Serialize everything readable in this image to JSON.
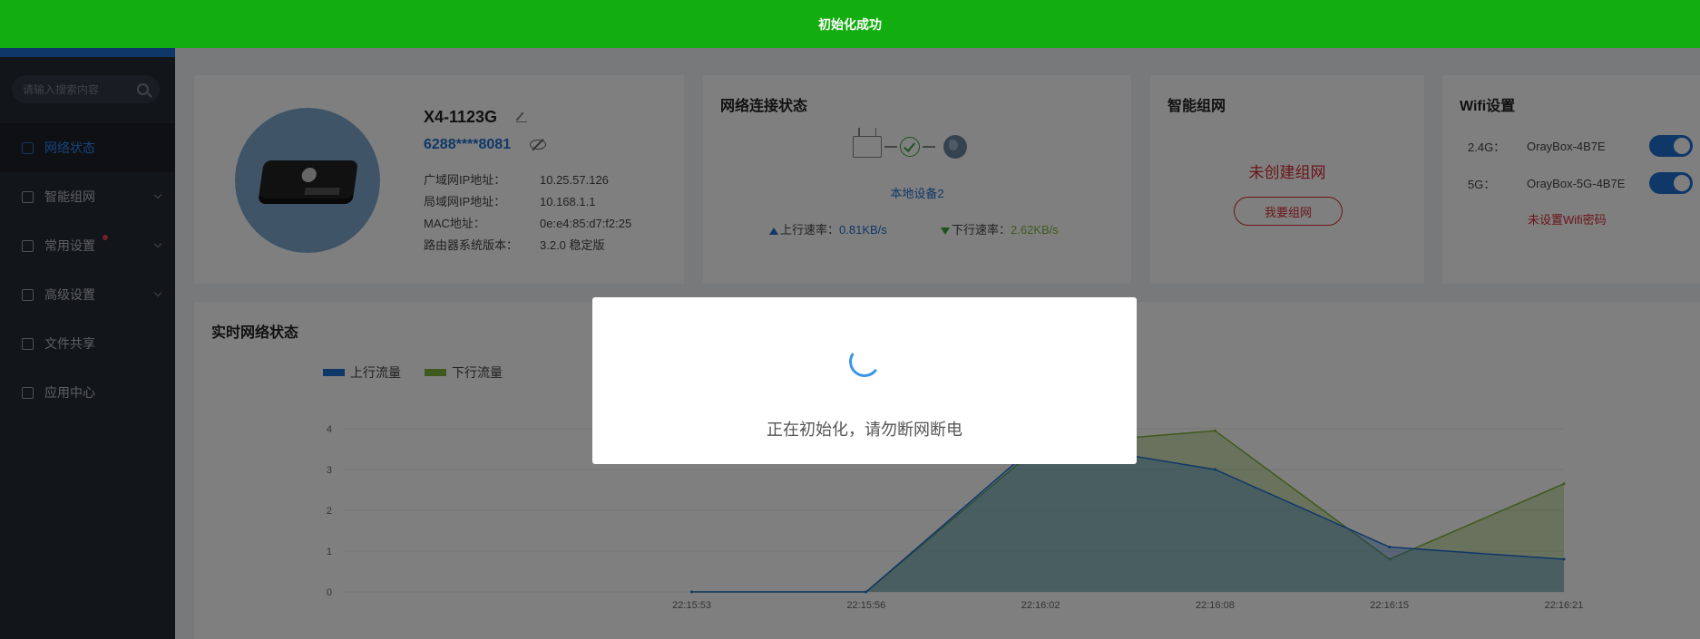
{
  "toast": {
    "message": "初始化成功"
  },
  "sidebar": {
    "search_placeholder": "请输入搜索内容",
    "items": [
      {
        "label": "网络状态",
        "icon": "network-status-icon",
        "active": true
      },
      {
        "label": "智能组网",
        "icon": "mesh-icon"
      },
      {
        "label": "常用设置",
        "icon": "settings-icon",
        "badge": true
      },
      {
        "label": "高级设置",
        "icon": "advanced-icon"
      },
      {
        "label": "文件共享",
        "icon": "folder-icon"
      },
      {
        "label": "应用中心",
        "icon": "app-icon"
      }
    ]
  },
  "device": {
    "name": "X4-1123G",
    "id": "6288****8081",
    "fields": [
      {
        "key": "广域网IP地址：",
        "value": "10.25.57.126"
      },
      {
        "key": "局域网IP地址：",
        "value": "10.168.1.1"
      },
      {
        "key": "MAC地址：",
        "value": "0e:e4:85:d7:f2:25"
      },
      {
        "key": "路由器系统版本：",
        "value": "3.2.0 稳定版"
      }
    ]
  },
  "network": {
    "title": "网络连接状态",
    "local_device": "本地设备2",
    "up_label": "上行速率：",
    "up_value": "0.81KB/s",
    "down_label": "下行速率：",
    "down_value": "2.62KB/s"
  },
  "mesh": {
    "title": "智能组网",
    "status": "未创建组网",
    "button": "我要组网"
  },
  "wifi": {
    "title": "Wifi设置",
    "bands": [
      {
        "band": "2.4G：",
        "ssid": "OrayBox-4B7E",
        "enabled": true
      },
      {
        "band": "5G：",
        "ssid": "OrayBox-5G-4B7E",
        "enabled": true
      }
    ],
    "warning": "未设置Wifi密码"
  },
  "realtime": {
    "title": "实时网络状态"
  },
  "chart_data": {
    "type": "area",
    "title": "实时网络状态",
    "x": [
      "22:15:53",
      "22:15:56",
      "22:16:02",
      "22:16:08",
      "22:16:15",
      "22:16:21"
    ],
    "ylim": [
      0,
      4
    ],
    "yticks": [
      0,
      1,
      2,
      3,
      4
    ],
    "series": [
      {
        "name": "上行流量",
        "color": "#1f6fd1",
        "values": [
          0,
          0,
          3.7,
          3.0,
          1.1,
          0.8
        ]
      },
      {
        "name": "下行流量",
        "color": "#7fb53a",
        "values": [
          0,
          0,
          3.6,
          3.95,
          0.8,
          2.65
        ]
      }
    ],
    "legend": "top-left",
    "grid": true
  },
  "modal": {
    "message": "正在初始化，请勿断网断电"
  }
}
